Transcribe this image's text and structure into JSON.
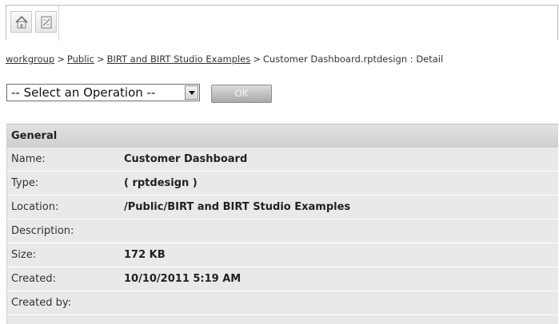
{
  "toolbar": {
    "home_icon": "home-icon",
    "document_icon": "document-icon"
  },
  "breadcrumb": {
    "items": [
      "workgroup",
      "Public",
      "BIRT and BIRT Studio Examples"
    ],
    "separator": ">",
    "current": "Customer Dashboard.rptdesign : Detail"
  },
  "operations": {
    "selected": "-- Select an Operation --",
    "ok_label": "OK"
  },
  "general": {
    "title": "General",
    "rows": [
      {
        "label": "Name:",
        "value": "Customer Dashboard"
      },
      {
        "label": "Type:",
        "value": "( rptdesign )"
      },
      {
        "label": "Location:",
        "value": "/Public/BIRT and BIRT Studio Examples"
      },
      {
        "label": "Description:",
        "value": ""
      },
      {
        "label": "Size:",
        "value": "172 KB"
      },
      {
        "label": "Created:",
        "value": "10/10/2011 5:19 AM"
      },
      {
        "label": "Created by:",
        "value": ""
      }
    ]
  }
}
